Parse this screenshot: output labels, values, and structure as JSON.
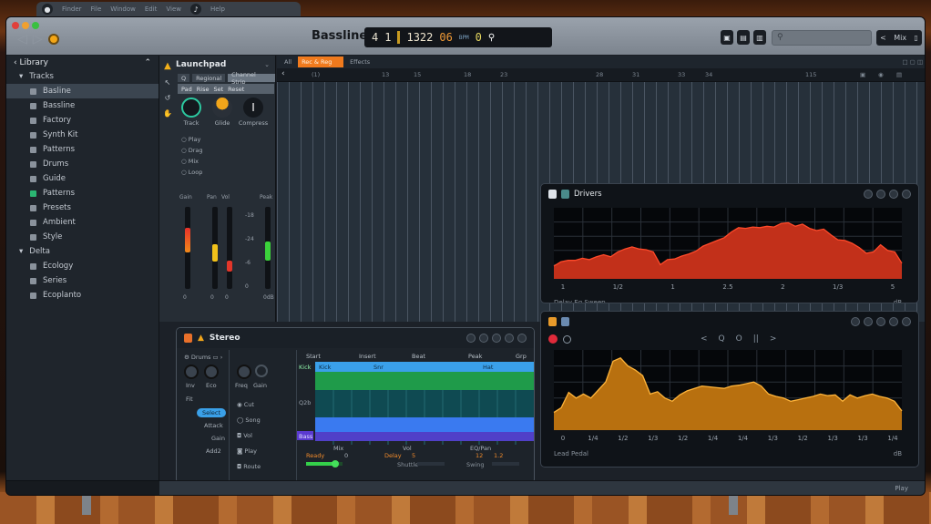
{
  "os_bar": {
    "items": [
      "Finder",
      "File",
      "Window",
      "Edit",
      "View",
      "Help"
    ]
  },
  "titlebar": {
    "title": "Bassline",
    "lcd": {
      "bar": "4",
      "beat": "1",
      "tempo": "1322",
      "sig": "06",
      "sig_sub": "BPM",
      "key": "0"
    },
    "buttons": [
      "view",
      "notes",
      "mixer"
    ],
    "search_placeholder": "",
    "share_label": "Mix"
  },
  "sidebar": {
    "header": "Library",
    "group": "Tracks",
    "items": [
      {
        "label": "Basline",
        "selected": true
      },
      {
        "label": "Bassline"
      },
      {
        "label": "Factory"
      },
      {
        "label": "Synth Kit"
      },
      {
        "label": "Patterns"
      },
      {
        "label": "Drums"
      },
      {
        "label": "Guide"
      },
      {
        "label": "Patterns",
        "accent": "#2bb673"
      },
      {
        "label": "Presets"
      },
      {
        "label": "Ambient"
      },
      {
        "label": "Style"
      }
    ],
    "group2": "Delta",
    "items2": [
      {
        "label": "Ecology"
      },
      {
        "label": "Series"
      },
      {
        "label": "Ecoplanto"
      }
    ]
  },
  "inspector": {
    "title": "Launchpad",
    "tabs": [
      "Q",
      "Regional",
      "Channel Strip"
    ],
    "subtabs": [
      "Pad",
      "Rise",
      "Set",
      "Reset"
    ],
    "knobs": [
      "Track",
      "Glide",
      "Compress"
    ],
    "options": [
      "Play",
      "Drag",
      "Mix",
      "Loop"
    ],
    "meter_labels": [
      "Gain",
      "Pan",
      "Vol",
      "Peak"
    ],
    "meter_levels": [
      0.75,
      0.55,
      0.35,
      0.58
    ],
    "meter_colors": [
      "#e8402a",
      "#f2c21a",
      "#e2362a",
      "#3bd23b"
    ],
    "scale": [
      "-18",
      "-24",
      "-6",
      "0"
    ],
    "foot": [
      "0",
      "0",
      "0",
      "0dB"
    ]
  },
  "arrange": {
    "tabs": [
      "All",
      "Rec & Reg",
      "Effects"
    ],
    "ruler": [
      "(1)",
      "13",
      "15",
      "18",
      "23",
      "28",
      "31",
      "33",
      "34",
      "115"
    ]
  },
  "panel_red": {
    "title": "Drivers",
    "x_ticks": [
      "1",
      "1/2",
      "1",
      "2.5",
      "2",
      "1/3",
      "5"
    ],
    "footer_left": "Delay Eq Sweep",
    "footer_right": "dB",
    "color": "#c2301a",
    "stroke": "#ff4a2a"
  },
  "editor": {
    "title": "Stereo",
    "left_label": "Drums",
    "knobs": [
      "Inv",
      "Eco"
    ],
    "knobs2": [
      "Freq",
      "Gain"
    ],
    "left_items": [
      "Fit",
      "Select",
      "Attack",
      "Gain",
      "Add2"
    ],
    "mid_items": [
      "Cut",
      "Song",
      "Vol",
      "Play",
      "Route"
    ],
    "track_headers": [
      "Start",
      "Insert",
      "Beat",
      "Peak",
      "Grp"
    ],
    "blue_region": [
      "Kick",
      "Snr",
      "Hat"
    ],
    "track_label1": "Kick",
    "track_label2": "Bass",
    "axis_label": "Q2b",
    "bottom": {
      "col1": "Mix",
      "col2": "Vol",
      "col3": "EQ/Pan",
      "v1": "Ready",
      "v1n": "0",
      "v2": "Delay",
      "v2n": "5",
      "v3n": "12",
      "v4n": "1.2",
      "sub2": "Shuttle",
      "sub3": "Swing"
    },
    "slider_value": 0.8
  },
  "panel_orange": {
    "transport": [
      "<",
      "Q",
      "O",
      "||",
      ">"
    ],
    "x_ticks": [
      "0",
      "1/4",
      "1/2",
      "1/3",
      "1/2",
      "1/4",
      "1/4",
      "1/3",
      "1/2",
      "1/3",
      "1/3",
      "1/4"
    ],
    "footer_left": "Lead Pedal",
    "footer_right": "dB",
    "color": "#b8700f",
    "stroke": "#ffb43a"
  },
  "status": {
    "right": "Play"
  }
}
